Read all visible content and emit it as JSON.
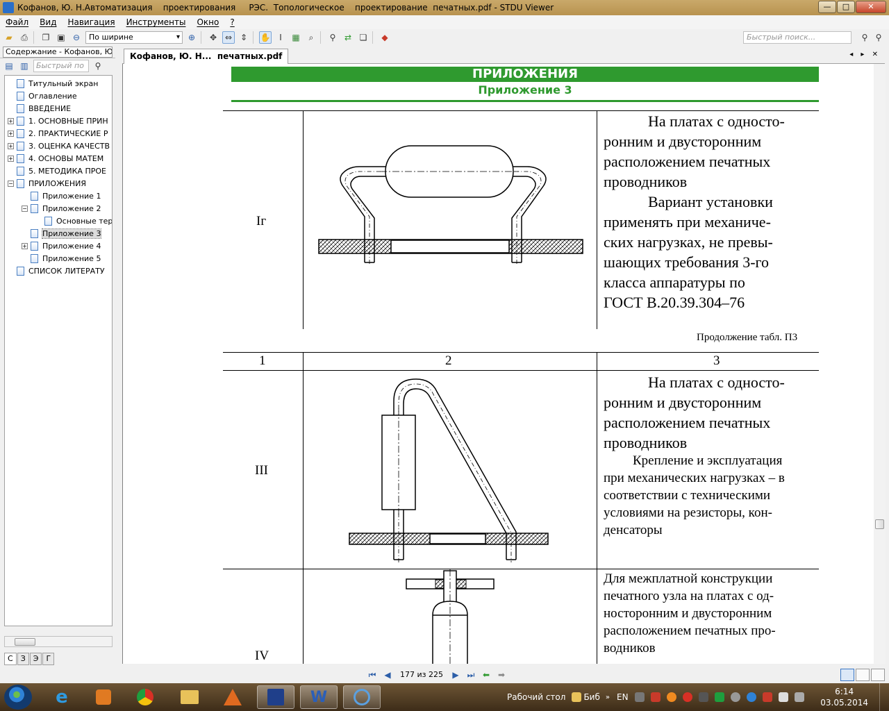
{
  "window": {
    "title": "Кофанов, Ю. Н.Автоматизация    проектирования     РЭС.  Топологическое    проектирование  печатных.pdf - STDU Viewer",
    "controls": {
      "minimize": "—",
      "maximize": "□",
      "close": "✕"
    }
  },
  "menu": {
    "items": [
      "Файл",
      "Вид",
      "Навигация",
      "Инструменты",
      "Окно",
      "?"
    ]
  },
  "toolbar": {
    "zoom_mode": "По ширине",
    "search_placeholder": "Быстрый поиск..."
  },
  "left_panel": {
    "header": "Содержание - Кофанов, Ю.",
    "search_placeholder": "Быстрый по",
    "tree": [
      {
        "label": "Титульный экран",
        "level": 0,
        "expander": ""
      },
      {
        "label": "Оглавление",
        "level": 0,
        "expander": ""
      },
      {
        "label": "ВВЕДЕНИЕ",
        "level": 0,
        "expander": ""
      },
      {
        "label": "1. ОСНОВНЫЕ  ПРИН",
        "level": 0,
        "expander": "+"
      },
      {
        "label": "2. ПРАКТИЧЕСКИЕ Р",
        "level": 0,
        "expander": "+"
      },
      {
        "label": "3. ОЦЕНКА КАЧЕСТВ",
        "level": 0,
        "expander": "+"
      },
      {
        "label": "4. ОСНОВЫ  МАТЕМ",
        "level": 0,
        "expander": "+"
      },
      {
        "label": "5. МЕТОДИКА ПРОЕ",
        "level": 0,
        "expander": ""
      },
      {
        "label": "ПРИЛОЖЕНИЯ",
        "level": 0,
        "expander": "−"
      },
      {
        "label": "Приложение 1",
        "level": 1,
        "expander": ""
      },
      {
        "label": "Приложение 2",
        "level": 1,
        "expander": "−"
      },
      {
        "label": "Основные тер",
        "level": 2,
        "expander": ""
      },
      {
        "label": "Приложение 3",
        "level": 1,
        "expander": "",
        "selected": true
      },
      {
        "label": "Приложение 4",
        "level": 1,
        "expander": "+"
      },
      {
        "label": "Приложение 5",
        "level": 1,
        "expander": ""
      },
      {
        "label": "СПИСОК  ЛИТЕРАТУ",
        "level": 0,
        "expander": ""
      }
    ],
    "bottom_tabs": [
      "С",
      "З",
      "Э",
      "Г"
    ]
  },
  "document": {
    "tab_label": "Кофанов, Ю. Н...  печатных.pdf",
    "header_band": "ПРИЛОЖЕНИЯ",
    "subtitle": "Приложение 3",
    "continuation": "Продолжение табл. П3",
    "col_headers": [
      "1",
      "2",
      "3"
    ],
    "rows": [
      {
        "label": "Iг",
        "lines": [
          "На платах с односто-",
          "ронним и двусторонним",
          "расположением печатных",
          "проводников",
          "Вариант установки",
          "применять при механиче-",
          "ских нагрузках, не превы-",
          "шающих требования 3-го",
          "класса аппаратуры по",
          "ГОСТ В.20.39.304–76"
        ]
      },
      {
        "label": "III",
        "lines_large": [
          "На платах с односто-",
          "ронним и двусторонним",
          "расположением печатных",
          "проводников"
        ],
        "lines": [
          "Крепление и эксплуатация",
          "при механических нагрузках – в",
          "соответствии с техническими",
          "условиями на резисторы, кон-",
          "денсаторы"
        ]
      },
      {
        "label": "IV",
        "lines": [
          "Для межплатной конструкции",
          "печатного узла на платах с од-",
          "носторонним и двусторонним",
          "расположением печатных про-",
          "водников"
        ]
      }
    ]
  },
  "status": {
    "page_indicator": "177 из 225"
  },
  "taskbar": {
    "desktop_label": "Рабочий стол",
    "bib_label": "Биб",
    "lang": "EN",
    "time": "6:14",
    "date": "03.05.2014",
    "word_icon": "W"
  }
}
